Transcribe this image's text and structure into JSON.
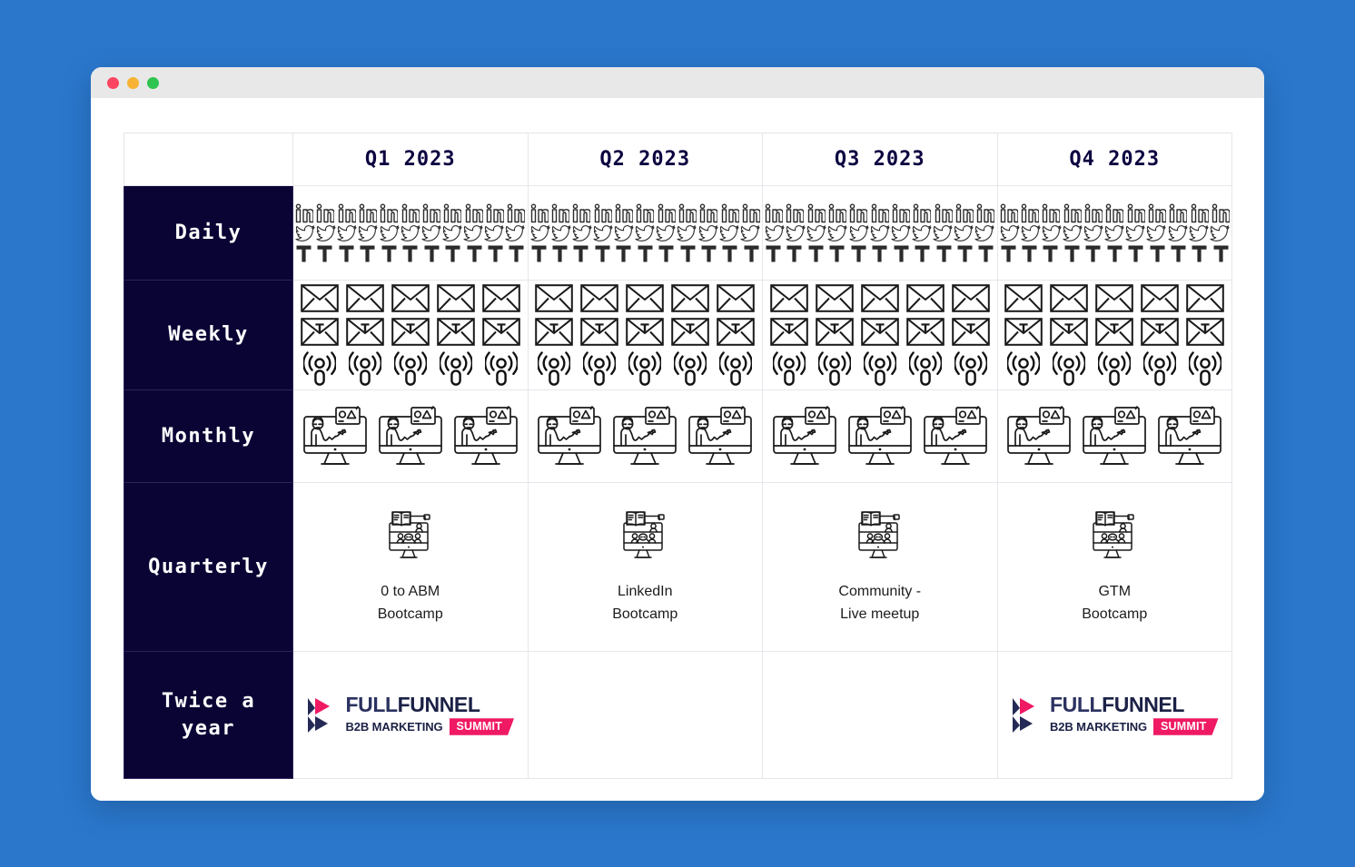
{
  "window": {
    "traffic_lights": [
      "close",
      "minimize",
      "maximize"
    ]
  },
  "table": {
    "corner_label": "",
    "columns": [
      {
        "id": "q1",
        "label": "Q1 2023"
      },
      {
        "id": "q2",
        "label": "Q2 2023"
      },
      {
        "id": "q3",
        "label": "Q3 2023"
      },
      {
        "id": "q4",
        "label": "Q4 2023"
      }
    ],
    "rows": [
      {
        "id": "daily",
        "label": "Daily",
        "cells": [
          {
            "icon_rows": [
              {
                "icon": "linkedin-icon",
                "count": 11
              },
              {
                "icon": "twitter-bird-icon",
                "count": 11
              },
              {
                "icon": "letter-t-icon",
                "count": 11
              }
            ]
          },
          {
            "icon_rows": [
              {
                "icon": "linkedin-icon",
                "count": 11
              },
              {
                "icon": "twitter-bird-icon",
                "count": 11
              },
              {
                "icon": "letter-t-icon",
                "count": 11
              }
            ]
          },
          {
            "icon_rows": [
              {
                "icon": "linkedin-icon",
                "count": 11
              },
              {
                "icon": "twitter-bird-icon",
                "count": 11
              },
              {
                "icon": "letter-t-icon",
                "count": 11
              }
            ]
          },
          {
            "icon_rows": [
              {
                "icon": "linkedin-icon",
                "count": 11
              },
              {
                "icon": "twitter-bird-icon",
                "count": 11
              },
              {
                "icon": "letter-t-icon",
                "count": 11
              }
            ]
          }
        ]
      },
      {
        "id": "weekly",
        "label": "Weekly",
        "cells": [
          {
            "icon_rows": [
              {
                "icon": "envelope-icon",
                "count": 5
              },
              {
                "icon": "envelope-t-icon",
                "count": 5
              },
              {
                "icon": "podcast-icon",
                "count": 5
              }
            ]
          },
          {
            "icon_rows": [
              {
                "icon": "envelope-icon",
                "count": 5
              },
              {
                "icon": "envelope-t-icon",
                "count": 5
              },
              {
                "icon": "podcast-icon",
                "count": 5
              }
            ]
          },
          {
            "icon_rows": [
              {
                "icon": "envelope-icon",
                "count": 5
              },
              {
                "icon": "envelope-t-icon",
                "count": 5
              },
              {
                "icon": "podcast-icon",
                "count": 5
              }
            ]
          },
          {
            "icon_rows": [
              {
                "icon": "envelope-icon",
                "count": 5
              },
              {
                "icon": "envelope-t-icon",
                "count": 5
              },
              {
                "icon": "podcast-icon",
                "count": 5
              }
            ]
          }
        ]
      },
      {
        "id": "monthly",
        "label": "Monthly",
        "cells": [
          {
            "icon_rows": [
              {
                "icon": "webinar-icon",
                "count": 3
              }
            ]
          },
          {
            "icon_rows": [
              {
                "icon": "webinar-icon",
                "count": 3
              }
            ]
          },
          {
            "icon_rows": [
              {
                "icon": "webinar-icon",
                "count": 3
              }
            ]
          },
          {
            "icon_rows": [
              {
                "icon": "webinar-icon",
                "count": 3
              }
            ]
          }
        ]
      },
      {
        "id": "quarterly",
        "label": "Quarterly",
        "cells": [
          {
            "icon": "online-course-icon",
            "label": "0 to ABM\nBootcamp"
          },
          {
            "icon": "online-course-icon",
            "label": "LinkedIn\nBootcamp"
          },
          {
            "icon": "online-course-icon",
            "label": "Community -\nLive meetup"
          },
          {
            "icon": "online-course-icon",
            "label": "GTM\nBootcamp"
          }
        ]
      },
      {
        "id": "twice",
        "label": "Twice a\nyear",
        "cells": [
          {
            "logo": true
          },
          {
            "logo": false
          },
          {
            "logo": false
          },
          {
            "logo": true
          }
        ]
      }
    ]
  },
  "logo": {
    "name": "fullfunnel-b2b-marketing-summit-logo",
    "word_first": "FULL",
    "word_second": "FUNNEL",
    "tagline": "B2B MARKETING",
    "badge": "SUMMIT"
  },
  "colors": {
    "background_blue": "#2a77cc",
    "row_label_navy": "#0a0435",
    "header_text_navy": "#0b0440",
    "logo_pink": "#ef1a63",
    "logo_navy": "#1b2146",
    "grid_line": "#e6e6ec",
    "titlebar": "#e8e8e8",
    "dot_red": "#fc4561",
    "dot_yellow": "#f8b335",
    "dot_green": "#2ec44f"
  }
}
